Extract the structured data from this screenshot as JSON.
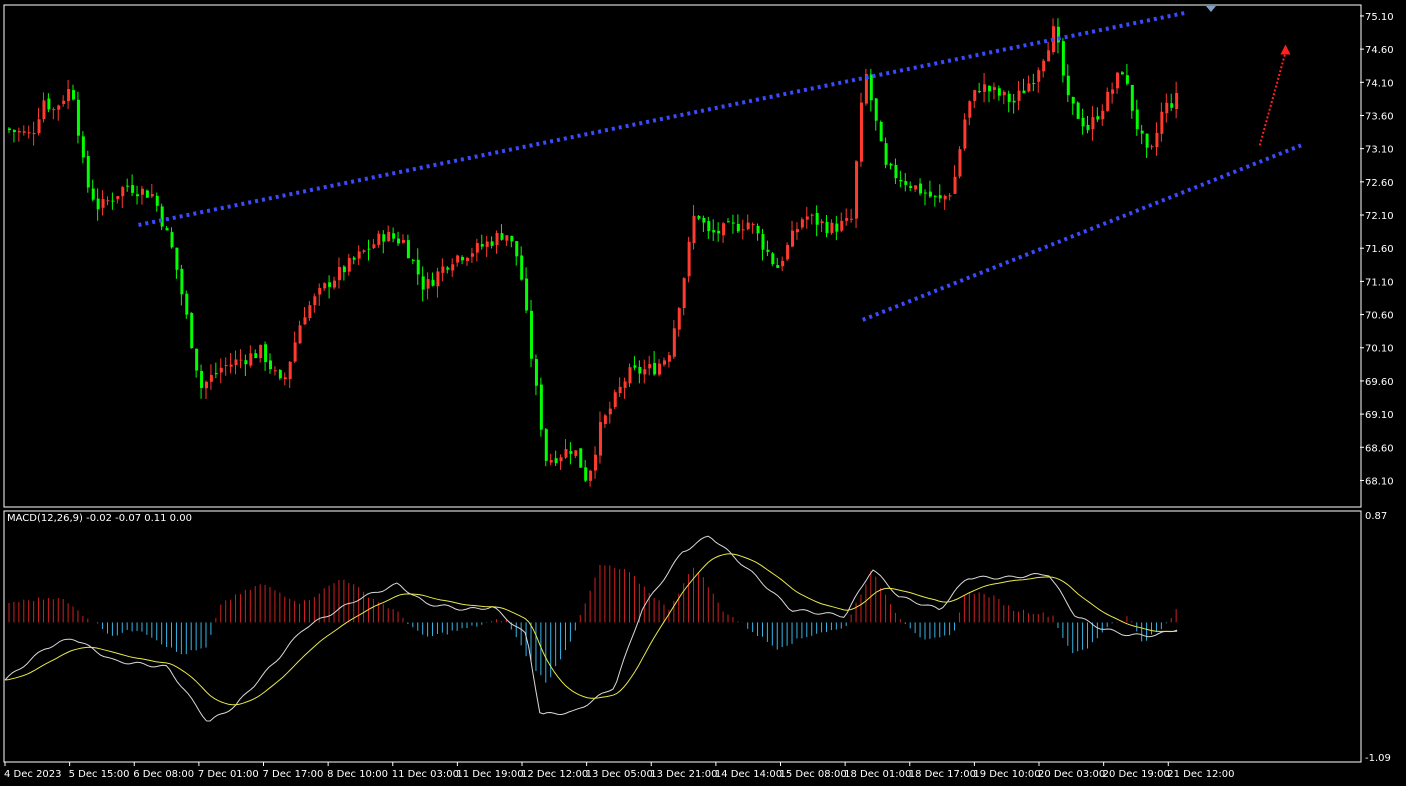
{
  "chart_data": {
    "type": "candlestick",
    "price_panel": {
      "y_ticks": [
        "75.10",
        "74.60",
        "74.10",
        "73.60",
        "73.10",
        "72.60",
        "72.10",
        "71.60",
        "71.10",
        "70.60",
        "70.10",
        "69.60",
        "69.10",
        "68.60",
        "68.10"
      ],
      "ylim": [
        67.7,
        75.25
      ],
      "channel_upper": [
        [
          0.0985,
          71.95
        ],
        [
          0.872,
          75.15
        ]
      ],
      "channel_lower": [
        [
          0.633,
          70.52
        ],
        [
          0.9565,
          73.15
        ]
      ],
      "arrow_dir": "up"
    },
    "macd_panel": {
      "label": "MACD(12,26,9) -0.02 -0.07 0.11 0.00",
      "y_max_label": "0.87",
      "y_min_label": "-1.09",
      "ylim": [
        -1.09,
        0.87
      ]
    },
    "x_ticks": [
      "4 Dec 2023",
      "5 Dec 15:00",
      "6 Dec 08:00",
      "7 Dec 01:00",
      "7 Dec 17:00",
      "8 Dec 10:00",
      "11 Dec 03:00",
      "11 Dec 19:00",
      "12 Dec 12:00",
      "13 Dec 05:00",
      "13 Dec 21:00",
      "14 Dec 14:00",
      "15 Dec 08:00",
      "18 Dec 01:00",
      "18 Dec 17:00",
      "19 Dec 10:00",
      "20 Dec 03:00",
      "20 Dec 19:00",
      "21 Dec 12:00"
    ],
    "anchors": [
      [
        0,
        73.4
      ],
      [
        0.02,
        73.3
      ],
      [
        0.03,
        73.9
      ],
      [
        0.035,
        73.65
      ],
      [
        0.05,
        74.05
      ],
      [
        0.06,
        72.6
      ],
      [
        0.07,
        72.2
      ],
      [
        0.09,
        72.55
      ],
      [
        0.11,
        72.4
      ],
      [
        0.125,
        71.5
      ],
      [
        0.145,
        69.5
      ],
      [
        0.16,
        69.8
      ],
      [
        0.19,
        70.05
      ],
      [
        0.205,
        69.5
      ],
      [
        0.22,
        70.6
      ],
      [
        0.24,
        71.1
      ],
      [
        0.26,
        71.45
      ],
      [
        0.28,
        71.8
      ],
      [
        0.295,
        71.7
      ],
      [
        0.31,
        71.0
      ],
      [
        0.33,
        71.45
      ],
      [
        0.35,
        71.6
      ],
      [
        0.37,
        71.85
      ],
      [
        0.38,
        71.4
      ],
      [
        0.39,
        69.8
      ],
      [
        0.4,
        68.4
      ],
      [
        0.42,
        68.6
      ],
      [
        0.43,
        68.1
      ],
      [
        0.44,
        68.9
      ],
      [
        0.46,
        69.7
      ],
      [
        0.48,
        69.8
      ],
      [
        0.49,
        70.0
      ],
      [
        0.5,
        71.0
      ],
      [
        0.51,
        72.2
      ],
      [
        0.52,
        71.8
      ],
      [
        0.55,
        72.0
      ],
      [
        0.57,
        71.3
      ],
      [
        0.59,
        72.1
      ],
      [
        0.61,
        71.9
      ],
      [
        0.625,
        72.0
      ],
      [
        0.635,
        74.3
      ],
      [
        0.65,
        72.8
      ],
      [
        0.67,
        72.55
      ],
      [
        0.69,
        72.3
      ],
      [
        0.7,
        72.5
      ],
      [
        0.71,
        73.7
      ],
      [
        0.72,
        74.05
      ],
      [
        0.745,
        73.8
      ],
      [
        0.76,
        74.2
      ],
      [
        0.775,
        74.9
      ],
      [
        0.785,
        73.8
      ],
      [
        0.8,
        73.4
      ],
      [
        0.815,
        73.9
      ],
      [
        0.825,
        74.3
      ],
      [
        0.835,
        73.5
      ],
      [
        0.845,
        72.9
      ],
      [
        0.855,
        73.7
      ],
      [
        0.865,
        73.85
      ]
    ],
    "macd_anchors": [
      [
        0,
        -0.45
      ],
      [
        0.03,
        -0.2
      ],
      [
        0.05,
        -0.12
      ],
      [
        0.08,
        -0.3
      ],
      [
        0.12,
        -0.35
      ],
      [
        0.15,
        -0.78
      ],
      [
        0.17,
        -0.65
      ],
      [
        0.2,
        -0.3
      ],
      [
        0.22,
        -0.05
      ],
      [
        0.26,
        0.18
      ],
      [
        0.29,
        0.3
      ],
      [
        0.31,
        0.15
      ],
      [
        0.34,
        0.1
      ],
      [
        0.36,
        0.12
      ],
      [
        0.385,
        -0.1
      ],
      [
        0.395,
        -0.72
      ],
      [
        0.42,
        -0.7
      ],
      [
        0.45,
        -0.5
      ],
      [
        0.47,
        0.1
      ],
      [
        0.5,
        0.55
      ],
      [
        0.52,
        0.68
      ],
      [
        0.55,
        0.4
      ],
      [
        0.58,
        0.1
      ],
      [
        0.62,
        0.05
      ],
      [
        0.64,
        0.42
      ],
      [
        0.66,
        0.2
      ],
      [
        0.69,
        0.1
      ],
      [
        0.71,
        0.35
      ],
      [
        0.74,
        0.35
      ],
      [
        0.77,
        0.38
      ],
      [
        0.79,
        0.05
      ],
      [
        0.81,
        -0.05
      ],
      [
        0.83,
        -0.1
      ],
      [
        0.85,
        -0.1
      ],
      [
        0.865,
        -0.05
      ]
    ],
    "hist_anchors": [
      [
        0,
        0.15
      ],
      [
        0.04,
        0.2
      ],
      [
        0.06,
        0.05
      ],
      [
        0.08,
        -0.1
      ],
      [
        0.1,
        -0.05
      ],
      [
        0.13,
        -0.25
      ],
      [
        0.15,
        -0.2
      ],
      [
        0.16,
        0.15
      ],
      [
        0.19,
        0.3
      ],
      [
        0.22,
        0.15
      ],
      [
        0.25,
        0.35
      ],
      [
        0.27,
        0.2
      ],
      [
        0.29,
        0.08
      ],
      [
        0.31,
        -0.12
      ],
      [
        0.34,
        -0.05
      ],
      [
        0.37,
        0.03
      ],
      [
        0.385,
        -0.25
      ],
      [
        0.4,
        -0.48
      ],
      [
        0.42,
        -0.1
      ],
      [
        0.44,
        0.45
      ],
      [
        0.46,
        0.4
      ],
      [
        0.49,
        0.1
      ],
      [
        0.51,
        0.45
      ],
      [
        0.53,
        0.1
      ],
      [
        0.55,
        -0.05
      ],
      [
        0.57,
        -0.2
      ],
      [
        0.6,
        -0.08
      ],
      [
        0.62,
        -0.05
      ],
      [
        0.64,
        0.4
      ],
      [
        0.66,
        0.05
      ],
      [
        0.68,
        -0.15
      ],
      [
        0.7,
        -0.1
      ],
      [
        0.71,
        0.25
      ],
      [
        0.73,
        0.2
      ],
      [
        0.745,
        0.1
      ],
      [
        0.76,
        0.08
      ],
      [
        0.775,
        0.05
      ],
      [
        0.78,
        -0.1
      ],
      [
        0.79,
        -0.25
      ],
      [
        0.8,
        -0.2
      ],
      [
        0.815,
        -0.02
      ],
      [
        0.83,
        0.05
      ],
      [
        0.84,
        -0.15
      ],
      [
        0.855,
        -0.05
      ],
      [
        0.865,
        0.09
      ]
    ],
    "colors": {
      "bull": "#ff3b30",
      "bear": "#00ff00",
      "channel": "#3a4bff",
      "arrow": "#ff2020",
      "hist_pos": "#d02020",
      "hist_neg": "#35b4e6",
      "macd_line": "#d9d9d9",
      "signal_line": "#e8e84a",
      "border": "#ffffff"
    }
  }
}
